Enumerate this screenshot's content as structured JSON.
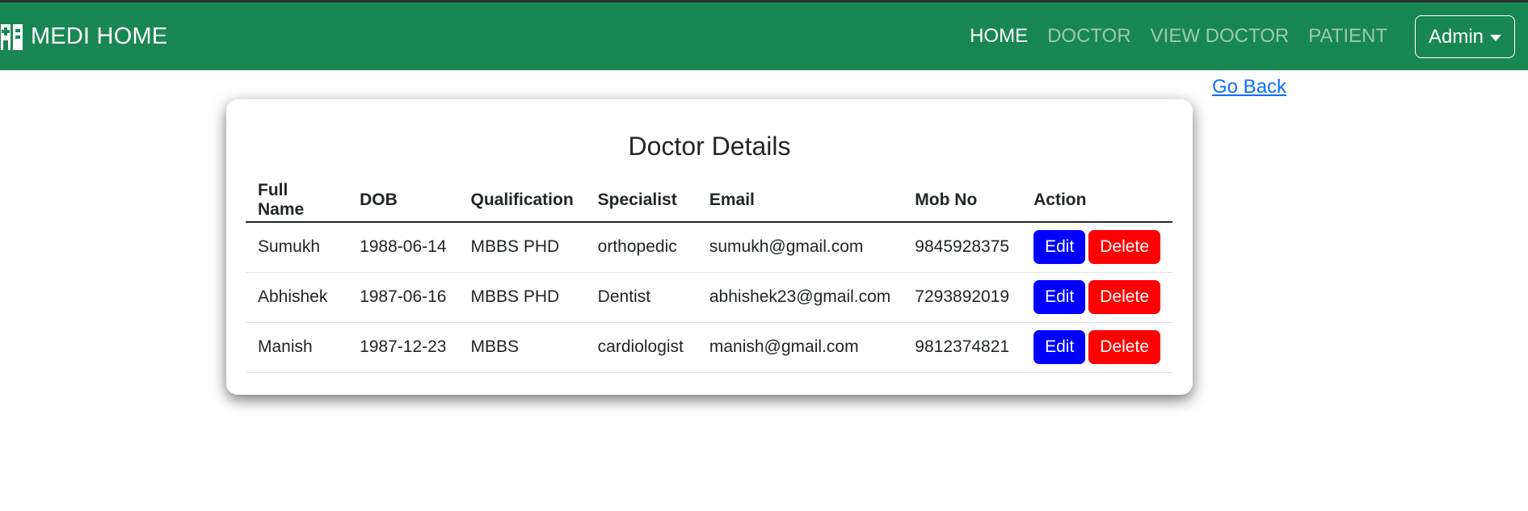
{
  "colors": {
    "navbar": "#198754",
    "edit": "#0000ff",
    "delete": "#ff0000",
    "link": "#0d6efd"
  },
  "brand": {
    "icon": "hospital-icon",
    "name": "MEDI HOME"
  },
  "nav": {
    "items": [
      {
        "label": "HOME",
        "active": true
      },
      {
        "label": "DOCTOR",
        "active": false
      },
      {
        "label": "VIEW DOCTOR",
        "active": false
      },
      {
        "label": "PATIENT",
        "active": false
      }
    ],
    "admin_label": "Admin"
  },
  "go_back": "Go Back",
  "card": {
    "title": "Doctor Details",
    "columns": [
      "Full Name",
      "DOB",
      "Qualification",
      "Specialist",
      "Email",
      "Mob No",
      "Action"
    ],
    "rows": [
      {
        "name": "Sumukh",
        "dob": "1988-06-14",
        "qualification": "MBBS PHD",
        "specialist": "orthopedic",
        "email": "sumukh@gmail.com",
        "mobile": "9845928375",
        "edit": "Edit",
        "delete": "Delete"
      },
      {
        "name": "Abhishek",
        "dob": "1987-06-16",
        "qualification": "MBBS PHD",
        "specialist": "Dentist",
        "email": "abhishek23@gmail.com",
        "mobile": "7293892019",
        "edit": "Edit",
        "delete": "Delete"
      },
      {
        "name": "Manish",
        "dob": "1987-12-23",
        "qualification": "MBBS",
        "specialist": "cardiologist",
        "email": "manish@gmail.com",
        "mobile": "9812374821",
        "edit": "Edit",
        "delete": "Delete"
      }
    ]
  }
}
